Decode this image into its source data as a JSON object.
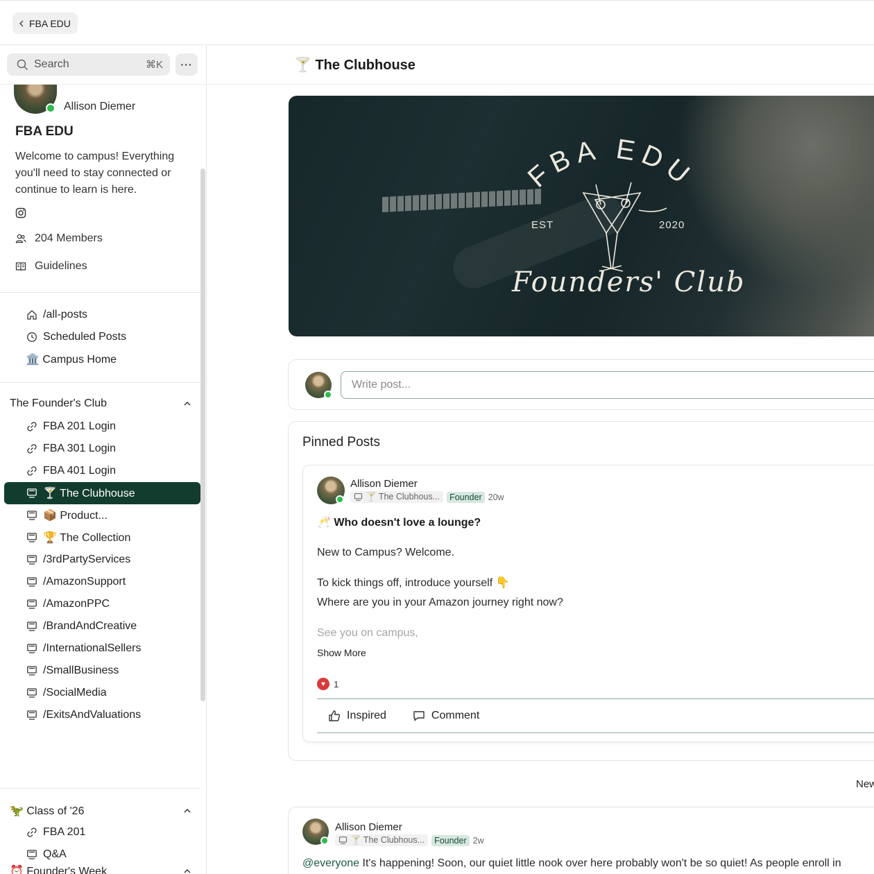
{
  "topbar": {
    "back_label": "FBA EDU"
  },
  "search": {
    "placeholder": "Search",
    "shortcut": "⌘K",
    "more_label": "···"
  },
  "space": {
    "owner_name": "Allison Diemer",
    "title": "FBA EDU",
    "description": "Welcome to campus! Everything you'll need to stay connected or continue to learn is here.",
    "members": "204 Members",
    "guidelines": "Guidelines",
    "instagram_icon": "instagram-icon"
  },
  "nav": {
    "top_items": [
      {
        "label": "/all-posts",
        "icon": "home-icon"
      },
      {
        "label": "Scheduled Posts",
        "icon": "clock-icon"
      },
      {
        "label": "🏛️ Campus Home",
        "icon": ""
      }
    ],
    "sections": [
      {
        "title": "The Founder's Club",
        "items": [
          {
            "label": "FBA 201 Login",
            "icon": "link-icon"
          },
          {
            "label": "FBA 301 Login",
            "icon": "link-icon"
          },
          {
            "label": "FBA 401 Login",
            "icon": "link-icon"
          },
          {
            "label": "🍸 The Clubhouse",
            "icon": "monitor-icon",
            "active": true
          },
          {
            "label": "📦 Product...",
            "icon": "monitor-icon"
          },
          {
            "label": "🏆 The Collection",
            "icon": "monitor-icon"
          },
          {
            "label": "/3rdPartyServices",
            "icon": "monitor-icon"
          },
          {
            "label": "/AmazonSupport",
            "icon": "monitor-icon"
          },
          {
            "label": "/AmazonPPC",
            "icon": "monitor-icon"
          },
          {
            "label": "/BrandAndCreative",
            "icon": "monitor-icon"
          },
          {
            "label": "/InternationalSellers",
            "icon": "monitor-icon"
          },
          {
            "label": "/SmallBusiness",
            "icon": "monitor-icon"
          },
          {
            "label": "/SocialMedia",
            "icon": "monitor-icon"
          },
          {
            "label": "/ExitsAndValuations",
            "icon": "monitor-icon"
          }
        ]
      },
      {
        "title": "🦖 Class of '26",
        "items": [
          {
            "label": "FBA 201",
            "icon": "link-icon"
          },
          {
            "label": "Q&A",
            "icon": "monitor-icon"
          }
        ]
      },
      {
        "title": "⏰ Founder's Week",
        "items": []
      }
    ]
  },
  "main": {
    "title": "🍸 The Clubhouse",
    "banner": {
      "brand": "FBA EDU",
      "est": "EST",
      "year": "2020",
      "script": "Founders' Club"
    },
    "composer_placeholder": "Write post...",
    "pinned_title": "Pinned Posts",
    "sort_label": "New",
    "pinned_post": {
      "author": "Allison Diemer",
      "space": "🍸 The Clubhous...",
      "badge": "Founder",
      "age": "20w",
      "title": "🥂 Who doesn't love a lounge?",
      "body_1": "New to Campus? Welcome.",
      "body_2": "To kick things off, introduce yourself 👇",
      "body_3": "Where are you in your Amazon journey right now?",
      "body_4": "See you on campus,",
      "show_more": "Show More",
      "reaction_count": "1",
      "action_inspired": "Inspired",
      "action_comment": "Comment"
    },
    "feed_post": {
      "author": "Allison Diemer",
      "space": "🍸 The Clubhous...",
      "badge": "Founder",
      "age": "2w",
      "mention": "@everyone",
      "text": " It's happening! Soon, our quiet little nook over here probably won't be so quiet! As people enroll in"
    }
  },
  "colors": {
    "accent": "#123c2e",
    "online": "#2dbb4f",
    "badge_bg": "#d6e8df",
    "heart": "#d93b3b"
  }
}
